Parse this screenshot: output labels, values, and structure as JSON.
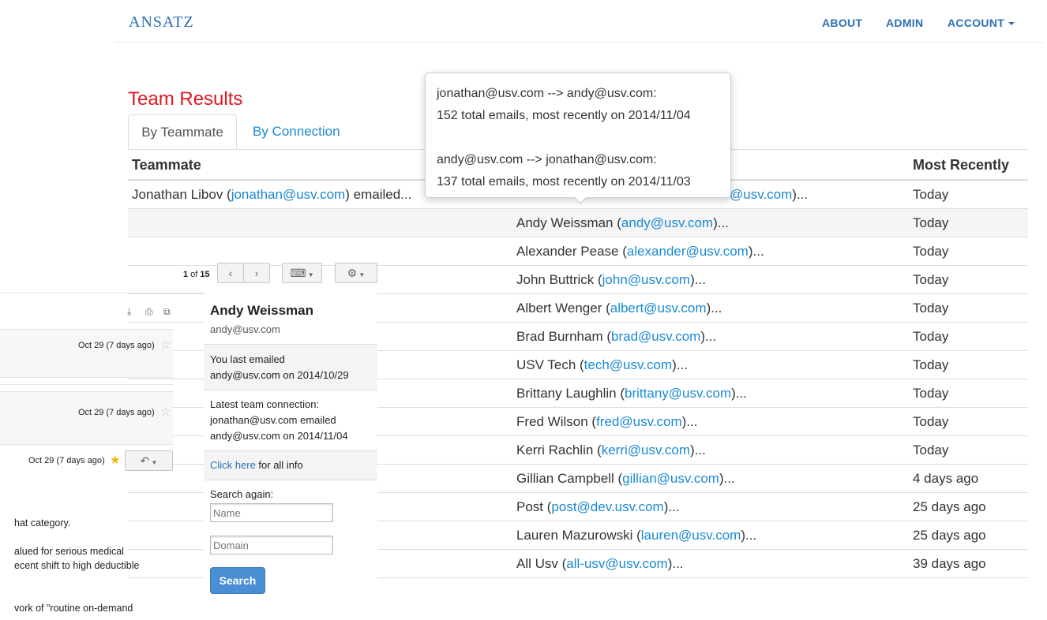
{
  "nav": {
    "brand": "ANSATZ",
    "about": "ABOUT",
    "admin": "ADMIN",
    "account": "ACCOUNT"
  },
  "results": {
    "title": "Team Results",
    "tabs": [
      "By Teammate",
      "By Connection"
    ],
    "headers": {
      "teammate": "Teammate",
      "most_recently": "Most Recently"
    },
    "first_row": {
      "name": "Jonathan Libov (",
      "email": "jonathan@usv.com",
      "suffix": ") emailed...",
      "contact_partial": "@usv.com",
      "contact_suffix": ")...",
      "date": "Today"
    },
    "rows": [
      {
        "name": "Andy Weissman (",
        "email": "andy@usv.com",
        "suffix": ")...",
        "date": "Today"
      },
      {
        "name": "Alexander Pease (",
        "email": "alexander@usv.com",
        "suffix": ")...",
        "date": "Today"
      },
      {
        "name": "John Buttrick (",
        "email": "john@usv.com",
        "suffix": ")...",
        "date": "Today"
      },
      {
        "name": "Albert Wenger (",
        "email": "albert@usv.com",
        "suffix": ")...",
        "date": "Today"
      },
      {
        "name": "Brad Burnham (",
        "email": "brad@usv.com",
        "suffix": ")...",
        "date": "Today"
      },
      {
        "name": "USV Tech (",
        "email": "tech@usv.com",
        "suffix": ")...",
        "date": "Today"
      },
      {
        "name": "Brittany Laughlin (",
        "email": "brittany@usv.com",
        "suffix": ")...",
        "date": "Today"
      },
      {
        "name": "Fred Wilson (",
        "email": "fred@usv.com",
        "suffix": ")...",
        "date": "Today"
      },
      {
        "name": "Kerri Rachlin (",
        "email": "kerri@usv.com",
        "suffix": ")...",
        "date": "Today"
      },
      {
        "name": "Gillian Campbell (",
        "email": "gillian@usv.com",
        "suffix": ")...",
        "date": "4 days ago"
      },
      {
        "name": "Post (",
        "email": "post@dev.usv.com",
        "suffix": ")...",
        "date": "25 days ago"
      },
      {
        "name": "Lauren Mazurowski (",
        "email": "lauren@usv.com",
        "suffix": ")...",
        "date": "25 days ago"
      },
      {
        "name": "All Usv (",
        "email": "all-usv@usv.com",
        "suffix": ")...",
        "date": "39 days ago"
      }
    ]
  },
  "tooltip": {
    "line1": "jonathan@usv.com --> andy@usv.com:",
    "line2": "152 total emails, most recently on 2014/11/04",
    "line3": "andy@usv.com --> jonathan@usv.com:",
    "line4": "137 total emails, most recently on 2014/11/03"
  },
  "gmail": {
    "pager": {
      "current": "1",
      "of": " of ",
      "total": "15"
    },
    "dates": [
      "Oct 29 (7 days ago)",
      "Oct 29 (7 days ago)",
      "Oct 29 (7 days ago)"
    ],
    "body_lines": [
      "hat category.",
      "alued for serious medical",
      "ecent shift to high deductible",
      "vork of \"routine on-demand"
    ]
  },
  "card": {
    "name": "Andy Weissman",
    "email": "andy@usv.com",
    "last_emailed_line1": "You last emailed",
    "last_emailed_line2": "andy@usv.com on 2014/10/29",
    "latest_line1": "Latest team connection:",
    "latest_line2": "jonathan@usv.com emailed",
    "latest_line3": "andy@usv.com on 2014/11/04",
    "click_here": "Click here",
    "all_info": " for all info",
    "search_again": "Search again:",
    "name_placeholder": "Name",
    "domain_placeholder": "Domain",
    "search_button": "Search"
  }
}
